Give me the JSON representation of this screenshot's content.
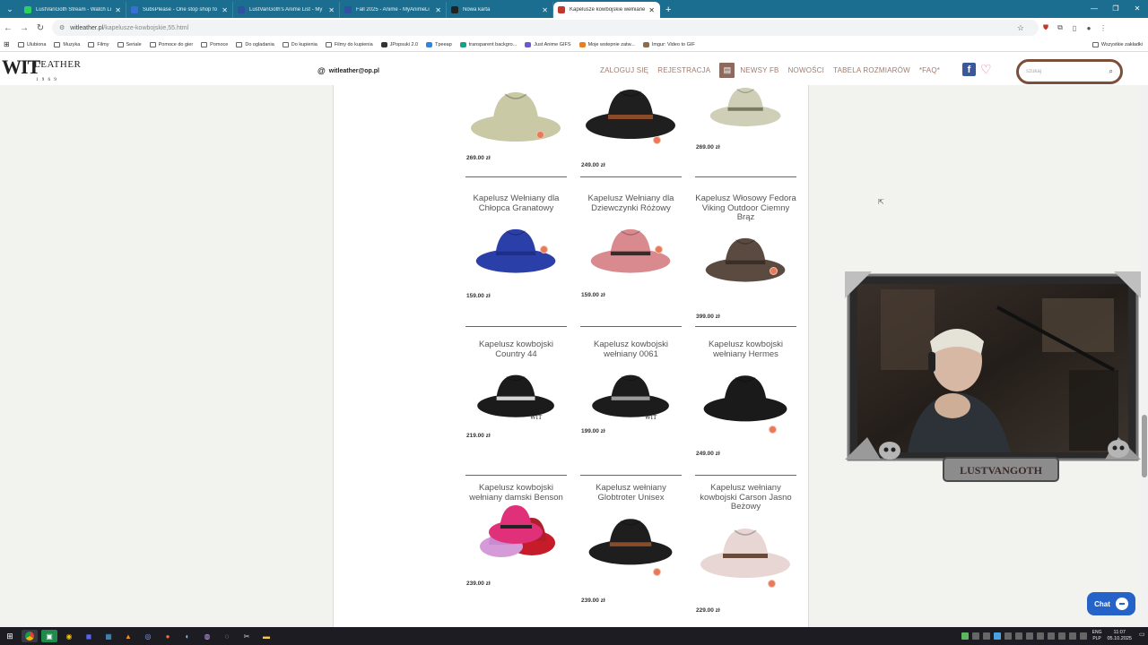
{
  "browser": {
    "tabs": [
      {
        "label": "LustVanGoth Stream - Watch Li",
        "color": "#2bd15a",
        "active": false
      },
      {
        "label": "SubsPlease - One stop shop fo",
        "color": "#3a6fd8",
        "active": false
      },
      {
        "label": "LustVanGoth's Anime List - My",
        "color": "#2e51a2",
        "active": false
      },
      {
        "label": "Fall 2025 - Anime - MyAnimeLi",
        "color": "#2e51a2",
        "active": false
      },
      {
        "label": "Nowa karta",
        "color": "#222222",
        "active": false
      },
      {
        "label": "Kapelusze kowbojskie wełniane",
        "color": "#c0392b",
        "active": true
      }
    ],
    "url_host": "witleather.pl",
    "url_path": "/kapelusze-kowbojskie,55.html",
    "bookmarks": [
      {
        "label": "Ulubiona",
        "icon": "folder-icon"
      },
      {
        "label": "Muzyka",
        "icon": "folder-icon"
      },
      {
        "label": "Filmy",
        "icon": "folder-icon"
      },
      {
        "label": "Seriale",
        "icon": "folder-icon"
      },
      {
        "label": "Pomoce do gier",
        "icon": "folder-icon"
      },
      {
        "label": "Pomoce",
        "icon": "folder-icon"
      },
      {
        "label": "Do ogladania",
        "icon": "folder-icon"
      },
      {
        "label": "Do kupienia",
        "icon": "folder-icon"
      },
      {
        "label": "Filmy do kupienia",
        "icon": "folder-icon"
      },
      {
        "label": "JPopsuki 2.0",
        "icon": "site-icon"
      },
      {
        "label": "Tpeeap",
        "icon": "site-icon"
      },
      {
        "label": "transparent backgro...",
        "icon": "site-icon"
      },
      {
        "label": "Just Anime GIFS",
        "icon": "site-icon"
      },
      {
        "label": "Moje wstepnie zatw...",
        "icon": "site-icon"
      },
      {
        "label": "Imgur: Video to GIF",
        "icon": "site-icon"
      }
    ],
    "all_bookmarks": "Wszystkie zakładki"
  },
  "site": {
    "logo_main": "WIT",
    "logo_sub": "LEATHER",
    "logo_year": "1 9 6 9",
    "email": "witleather@op.pl",
    "nav": [
      "ZALOGUJ SIĘ",
      "REJESTRACJA",
      "NEWSY FB",
      "NOWOŚCI",
      "TABELA ROZMIARÓW",
      "*FAQ*"
    ],
    "search_placeholder": "szukaj"
  },
  "products": [
    {
      "name": "",
      "price": "269.00 zł",
      "hat_color": "#c9c9a6",
      "band": "#c9c9a6"
    },
    {
      "name": "",
      "price": "249.00 zł",
      "hat_color": "#1f1f1f",
      "band": "#8a4b2a"
    },
    {
      "name": "",
      "price": "269.00 zł",
      "hat_color": "#cfcfb8",
      "band": "#7a7a60"
    },
    {
      "name": "Kapelusz Wełniany dla Chłopca Granatowy",
      "price": "159.00 zł",
      "hat_color": "#2b3fa8",
      "band": "#1e2f8a"
    },
    {
      "name": "Kapelusz Wełniany dla Dziewczynki Różowy",
      "price": "159.00 zł",
      "hat_color": "#d88a8e",
      "band": "#3a2a2a"
    },
    {
      "name": "Kapelusz Włosowy Fedora Viking Outdoor Ciemny Brąz",
      "price": "399.00 zł",
      "hat_color": "#5a4a40",
      "band": "#3b2e27"
    },
    {
      "name": "Kapelusz kowbojski Country 44",
      "price": "219.00 zł",
      "hat_color": "#1b1b1b",
      "band": "#d6d6d6"
    },
    {
      "name": "Kapelusz kowbojski wełniany 0061",
      "price": "199.00 zł",
      "hat_color": "#1c1c1c",
      "band": "#9a9a9a"
    },
    {
      "name": "Kapelusz kowbojski wełniany Hermes",
      "price": "249.00 zł",
      "hat_color": "#1a1a1a",
      "band": "#1a1a1a"
    },
    {
      "name": "Kapelusz kowbojski wełniany damski Benson",
      "price": "239.00 zł",
      "hat_color": "#e0307a",
      "band": "#b01e2a"
    },
    {
      "name": "Kapelusz wełniany Globtroter Unisex",
      "price": "239.00 zł",
      "hat_color": "#1e1e1e",
      "band": "#8a4b2a"
    },
    {
      "name": "Kapelusz wełniany kowbojski Carson Jasno Beżowy",
      "price": "229.00 zł",
      "hat_color": "#e8d6d4",
      "band": "#6a4a3a"
    }
  ],
  "product_logo_text": "WIT",
  "webcam": {
    "name_plate": "LUSTVANGOTH"
  },
  "chat_label": "Chat",
  "taskbar": {
    "lang_top": "ENG",
    "lang_bottom": "PLP",
    "time": "11:07",
    "date": "05.10.2025"
  }
}
